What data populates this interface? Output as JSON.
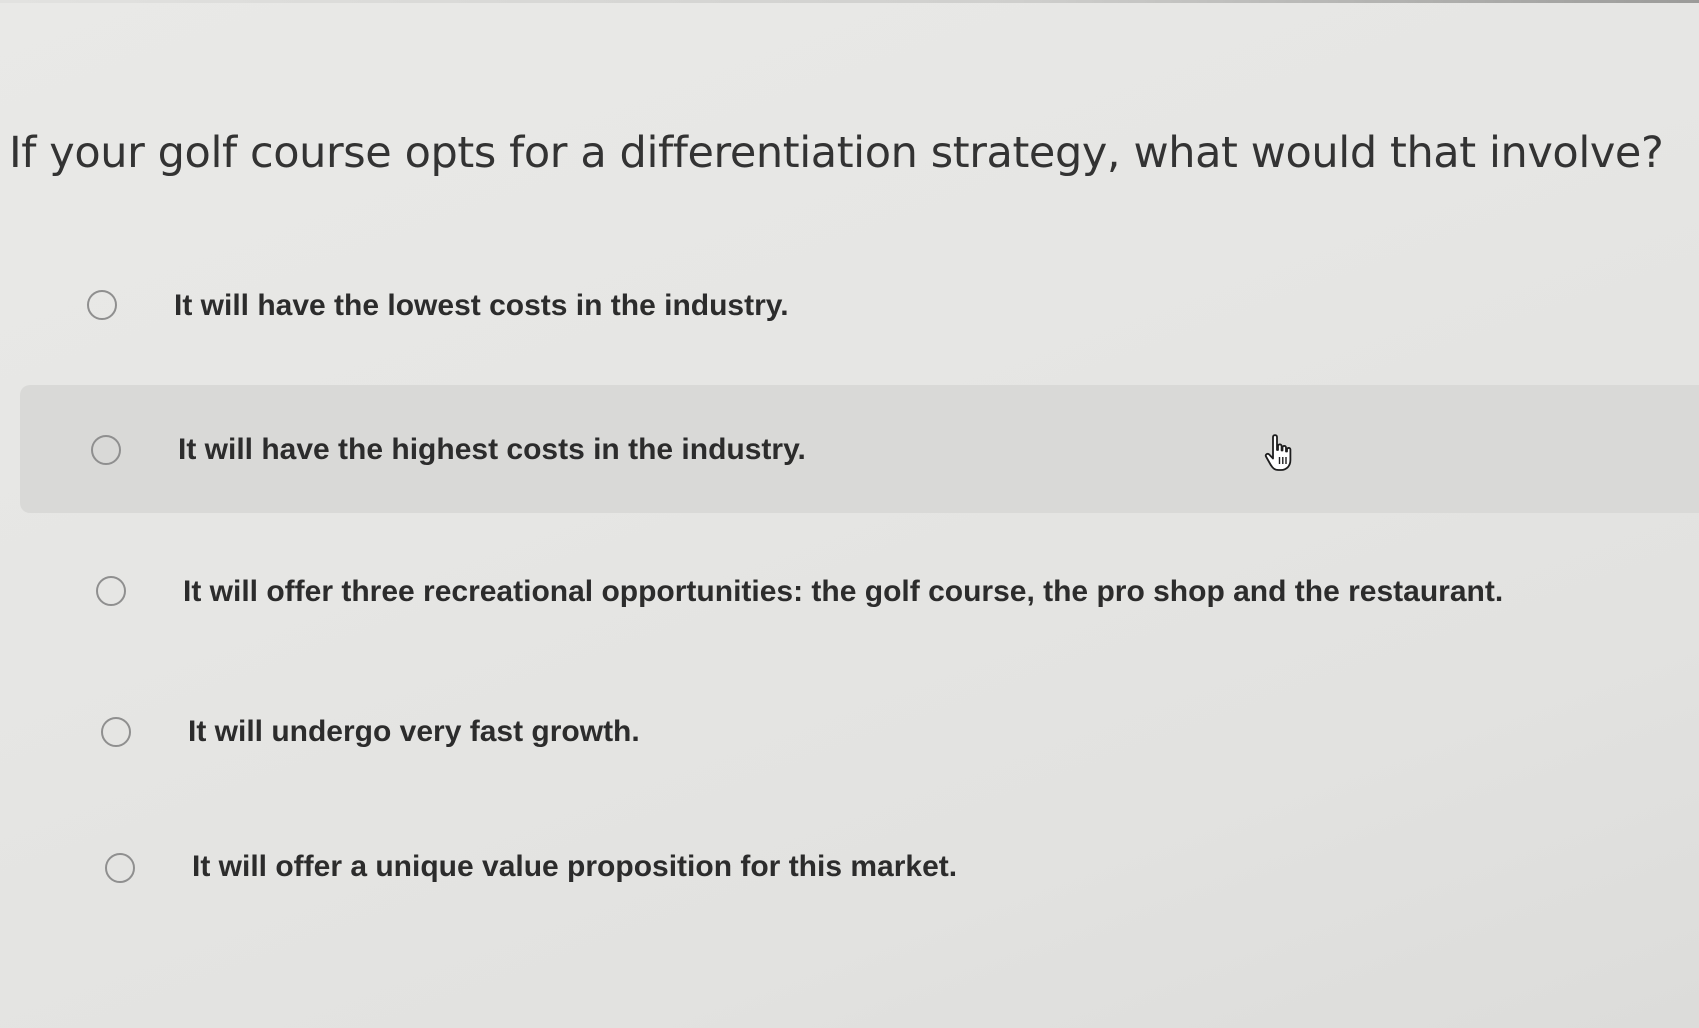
{
  "question": {
    "text": "If your golf course opts for a differentiation strategy, what would that involve?"
  },
  "options": [
    {
      "label": "It will have the lowest costs in the industry.",
      "selected": false
    },
    {
      "label": "It will have the highest costs in the industry.",
      "selected": false,
      "hovered": true
    },
    {
      "label": "It will offer three recreational opportunities: the golf course, the pro shop and the restaurant.",
      "selected": false
    },
    {
      "label": "It will undergo very fast growth.",
      "selected": false
    },
    {
      "label": "It will offer a unique value proposition for this market.",
      "selected": false
    }
  ],
  "icons": {
    "radio": "radio-button-icon",
    "cursor": "hand-pointer-icon"
  },
  "colors": {
    "background": "#e7e7e5",
    "hover_row": "#d9d9d7",
    "text": "#2c2c2c",
    "radio_border": "#8f8f8f"
  }
}
